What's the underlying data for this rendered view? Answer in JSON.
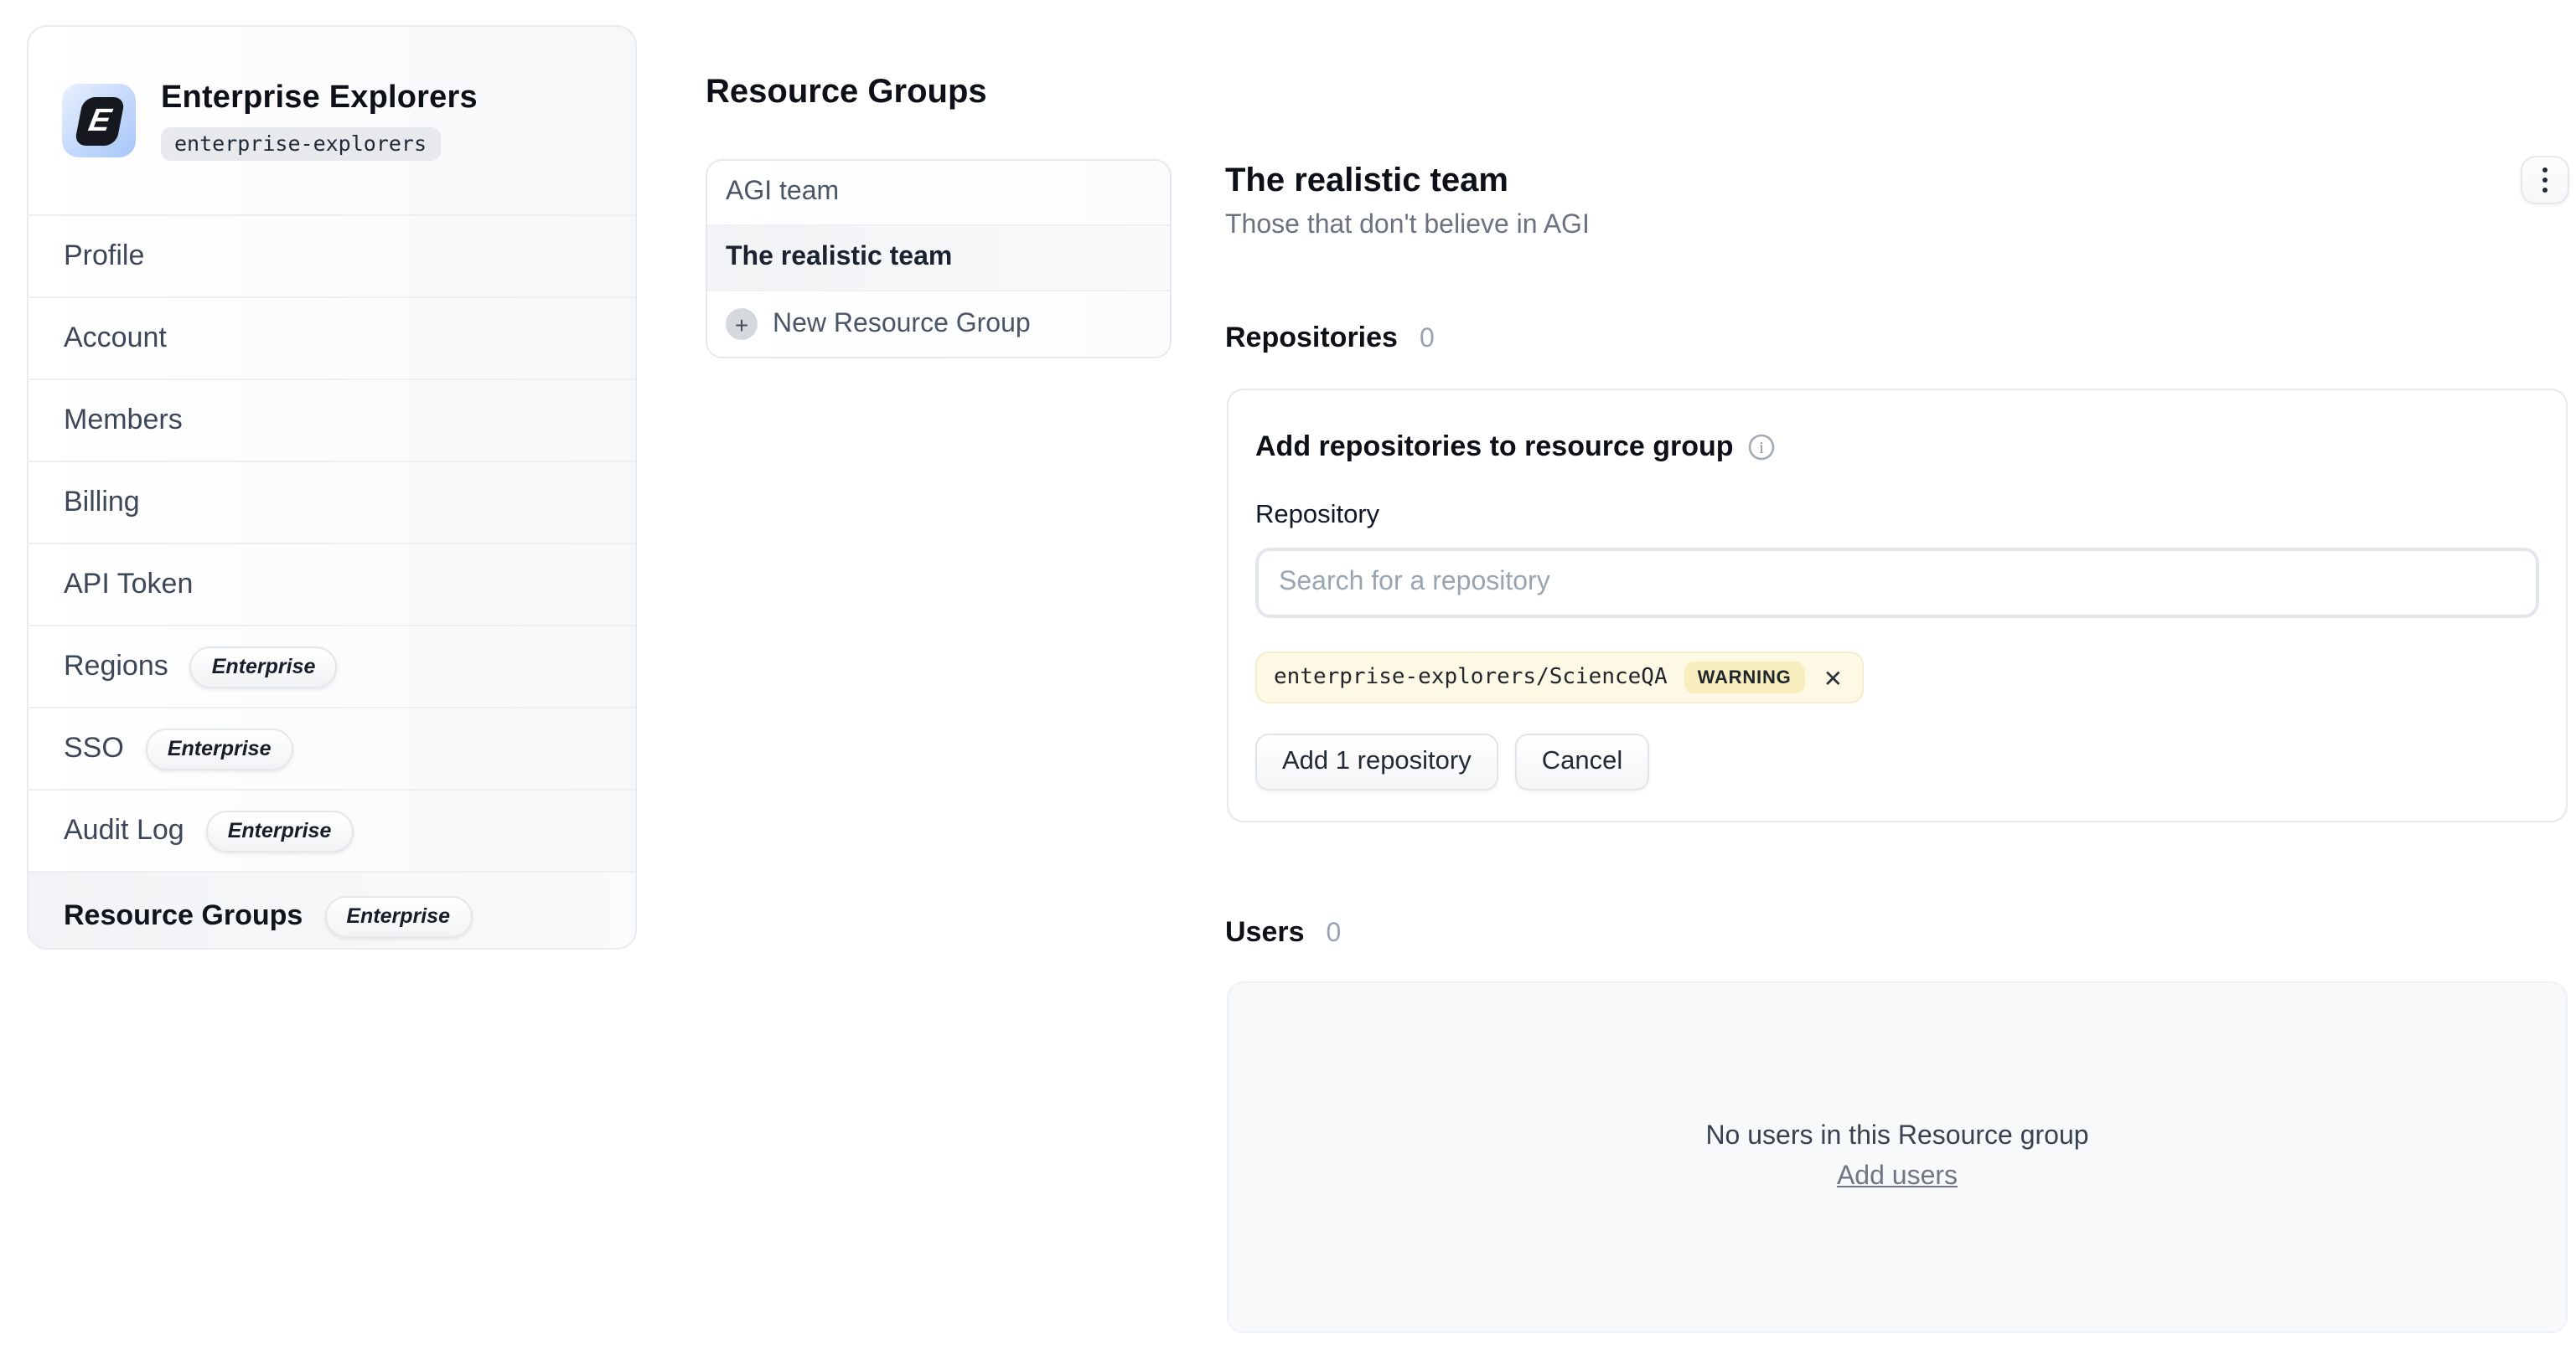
{
  "org": {
    "name": "Enterprise Explorers",
    "handle": "enterprise-explorers",
    "logo_letter": "E"
  },
  "sidebar": {
    "items": [
      {
        "label": "Profile"
      },
      {
        "label": "Account"
      },
      {
        "label": "Members"
      },
      {
        "label": "Billing"
      },
      {
        "label": "API Token"
      },
      {
        "label": "Regions",
        "badge": "Enterprise"
      },
      {
        "label": "SSO",
        "badge": "Enterprise"
      },
      {
        "label": "Audit Log",
        "badge": "Enterprise"
      },
      {
        "label": "Resource Groups",
        "badge": "Enterprise",
        "selected": true
      }
    ]
  },
  "groups_panel": {
    "title": "Resource Groups",
    "items": [
      "AGI team",
      "The realistic team"
    ],
    "selected": "The realistic team",
    "new_group_label": "New Resource Group",
    "plus_glyph": "+"
  },
  "detail": {
    "title": "The realistic team",
    "subtitle": "Those that don't believe in AGI",
    "repositories": {
      "heading": "Repositories",
      "count": "0",
      "card_title": "Add repositories to resource group",
      "field_label": "Repository",
      "search_placeholder": "Search for a repository",
      "chip": {
        "name": "enterprise-explorers/ScienceQA",
        "badge": "WARNING",
        "close_glyph": "✕"
      },
      "add_button": "Add 1 repository",
      "cancel_button": "Cancel"
    },
    "users": {
      "heading": "Users",
      "count": "0",
      "empty_text": "No users in this Resource group",
      "add_link": "Add users"
    }
  },
  "colors": {
    "chip_bg": "#fdf9e4",
    "chip_border": "#f4ecca",
    "warning_badge_bg": "#f8eebd",
    "logo_gradient_start": "#e9f1fe",
    "logo_gradient_end": "#a7c6f9",
    "selected_row_bg": "#f2f3f6",
    "panel_bg": "#f8f9fb"
  }
}
